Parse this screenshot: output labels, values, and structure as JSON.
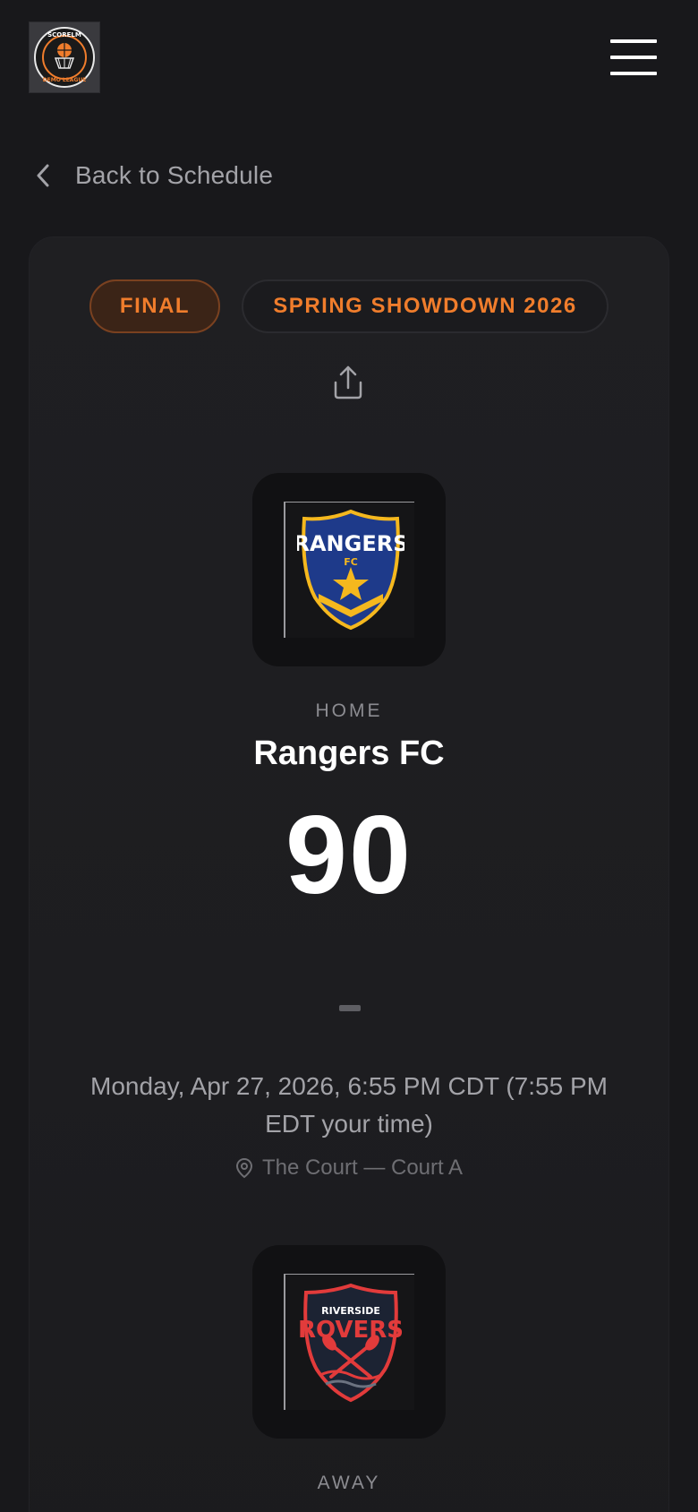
{
  "header": {
    "logo_icon": "scorelm-demo-league-logo",
    "logo_text_top": "SCORELM",
    "logo_text_bottom": "DEMO LEAGUE",
    "menu_icon": "hamburger-menu-icon"
  },
  "nav": {
    "back_label": "Back to Schedule",
    "back_icon": "chevron-left-icon"
  },
  "game": {
    "status": "FINAL",
    "event": "SPRING SHOWDOWN 2026",
    "share_icon": "share-icon",
    "home": {
      "side": "HOME",
      "name": "Rangers FC",
      "score": "90",
      "logo_text": "RANGERS",
      "logo_subtext": "FC"
    },
    "separator": "–",
    "datetime": "Monday, Apr 27, 2026, 6:55 PM CDT (7:55 PM EDT your time)",
    "venue": "The Court — Court A",
    "venue_icon": "map-pin-icon",
    "away": {
      "side": "AWAY",
      "logo_text_top": "RIVERSIDE",
      "logo_text": "ROVERS"
    }
  },
  "colors": {
    "background": "#18181b",
    "accent": "#f07d2c",
    "text_muted": "#a3a3a8",
    "rangers_blue": "#1e3a8a",
    "rangers_gold": "#f5b81e",
    "rovers_red": "#e23b3b"
  }
}
